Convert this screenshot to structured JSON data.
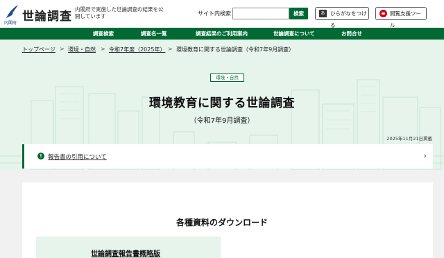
{
  "header": {
    "logo_title": "世論調査",
    "logo_sub": "内閣府",
    "tagline": "内閣府で実施した世論調査の結果を公開しています",
    "search_label": "サイト内検索",
    "search_placeholder": "",
    "search_button": "検索",
    "hiragana_button": "ひらがなをつける",
    "hiragana_icon_text": "あ",
    "tool_button": "閲覧支援ツール"
  },
  "nav": {
    "items": [
      {
        "label": "調査検索"
      },
      {
        "label": "調査名一覧"
      },
      {
        "label": "調査結果のご利用案内"
      },
      {
        "label": "世論調査について"
      },
      {
        "label": "お問合せ"
      }
    ]
  },
  "breadcrumb": {
    "items": [
      {
        "label": "トップページ"
      },
      {
        "label": "環境・自然"
      },
      {
        "label": "令和7年度（2025年）"
      },
      {
        "label": "環境教育に関する世論調査（令和7年9月調査）"
      }
    ],
    "separator": ">"
  },
  "hero": {
    "category": "環境・自然",
    "title": "環境教育に関する世論調査",
    "subtitle": "（令和7年9月調査）",
    "published": "2025年11月21日掲載"
  },
  "citation": {
    "icon_text": "!",
    "label": "報告書の引用について",
    "chevron": "›"
  },
  "downloads": {
    "heading": "各種資料のダウンロード",
    "first_item": "世論調査報告書概略版"
  },
  "colors": {
    "brand_green": "#006934",
    "light_green": "#e6f4ec",
    "accent_red": "#d0021b"
  }
}
